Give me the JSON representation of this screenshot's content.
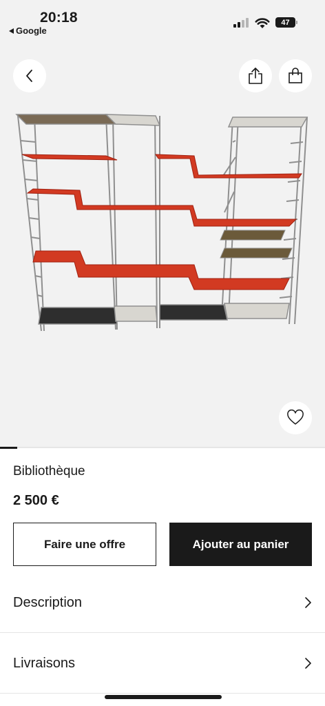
{
  "status_bar": {
    "time": "20:18",
    "back_app": "Google",
    "battery": "47"
  },
  "header": {
    "back_icon": "chevron-left-icon",
    "share_icon": "share-icon",
    "bag_icon": "shopping-bag-icon"
  },
  "gallery": {
    "favorite_icon": "heart-icon",
    "image_subject": "shelving-unit-image"
  },
  "product": {
    "title": "Bibliothèque",
    "price": "2 500 €"
  },
  "actions": {
    "offer_label": "Faire une offre",
    "cart_label": "Ajouter au panier"
  },
  "sections": [
    {
      "label": "Description"
    },
    {
      "label": "Livraisons"
    }
  ],
  "colors": {
    "accent": "#1a1a1a",
    "hero_background": "#f2f2f2",
    "shelf_red": "#d23a22"
  }
}
